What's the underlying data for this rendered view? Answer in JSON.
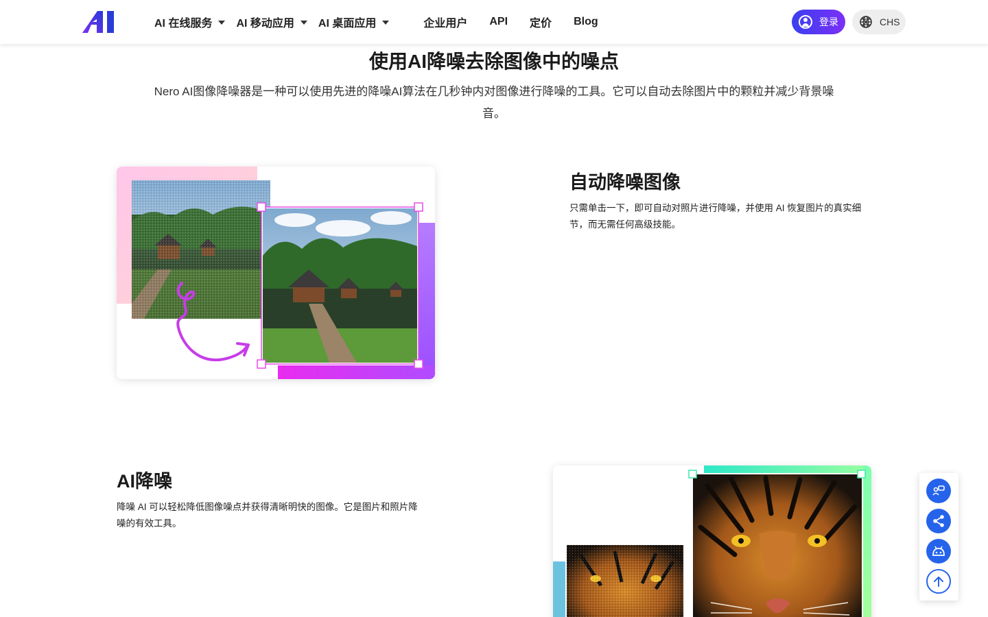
{
  "header": {
    "logo_icon": "ai-logo-icon",
    "nav": [
      {
        "label": "AI 在线服务",
        "dropdown": true
      },
      {
        "label": "AI 移动应用",
        "dropdown": true
      },
      {
        "label": "AI 桌面应用",
        "dropdown": true
      },
      {
        "label": "企业用户",
        "dropdown": false
      },
      {
        "label": "API",
        "dropdown": false
      },
      {
        "label": "定价",
        "dropdown": false
      },
      {
        "label": "Blog",
        "dropdown": false
      }
    ],
    "login_label": "登录",
    "lang_label": "CHS"
  },
  "intro": {
    "title": "使用AI降噪去除图像中的噪点",
    "desc": "Nero AI图像降噪器是一种可以使用先进的降噪AI算法在几秒钟内对图像进行降噪的工具。它可以自动去除图片中的颗粒并减少背景噪音。"
  },
  "feature1": {
    "title": "自动降噪图像",
    "desc": "只需单击一下，即可自动对照片进行降噪，并使用 AI 恢复图片的真实细节，而无需任何高级技能。"
  },
  "feature2": {
    "title": "AI降噪",
    "desc": "降噪 AI 可以轻松降低图像噪点并获得清晰明快的图像。它是图片和照片降噪的有效工具。"
  },
  "float_bar": {
    "icons": [
      "feedback-icon",
      "share-icon",
      "android-icon",
      "scroll-top-icon"
    ]
  },
  "colors": {
    "accent_blue": "#2563eb",
    "login_gradient_start": "#3b3ff0",
    "login_gradient_end": "#7b2ff7"
  }
}
